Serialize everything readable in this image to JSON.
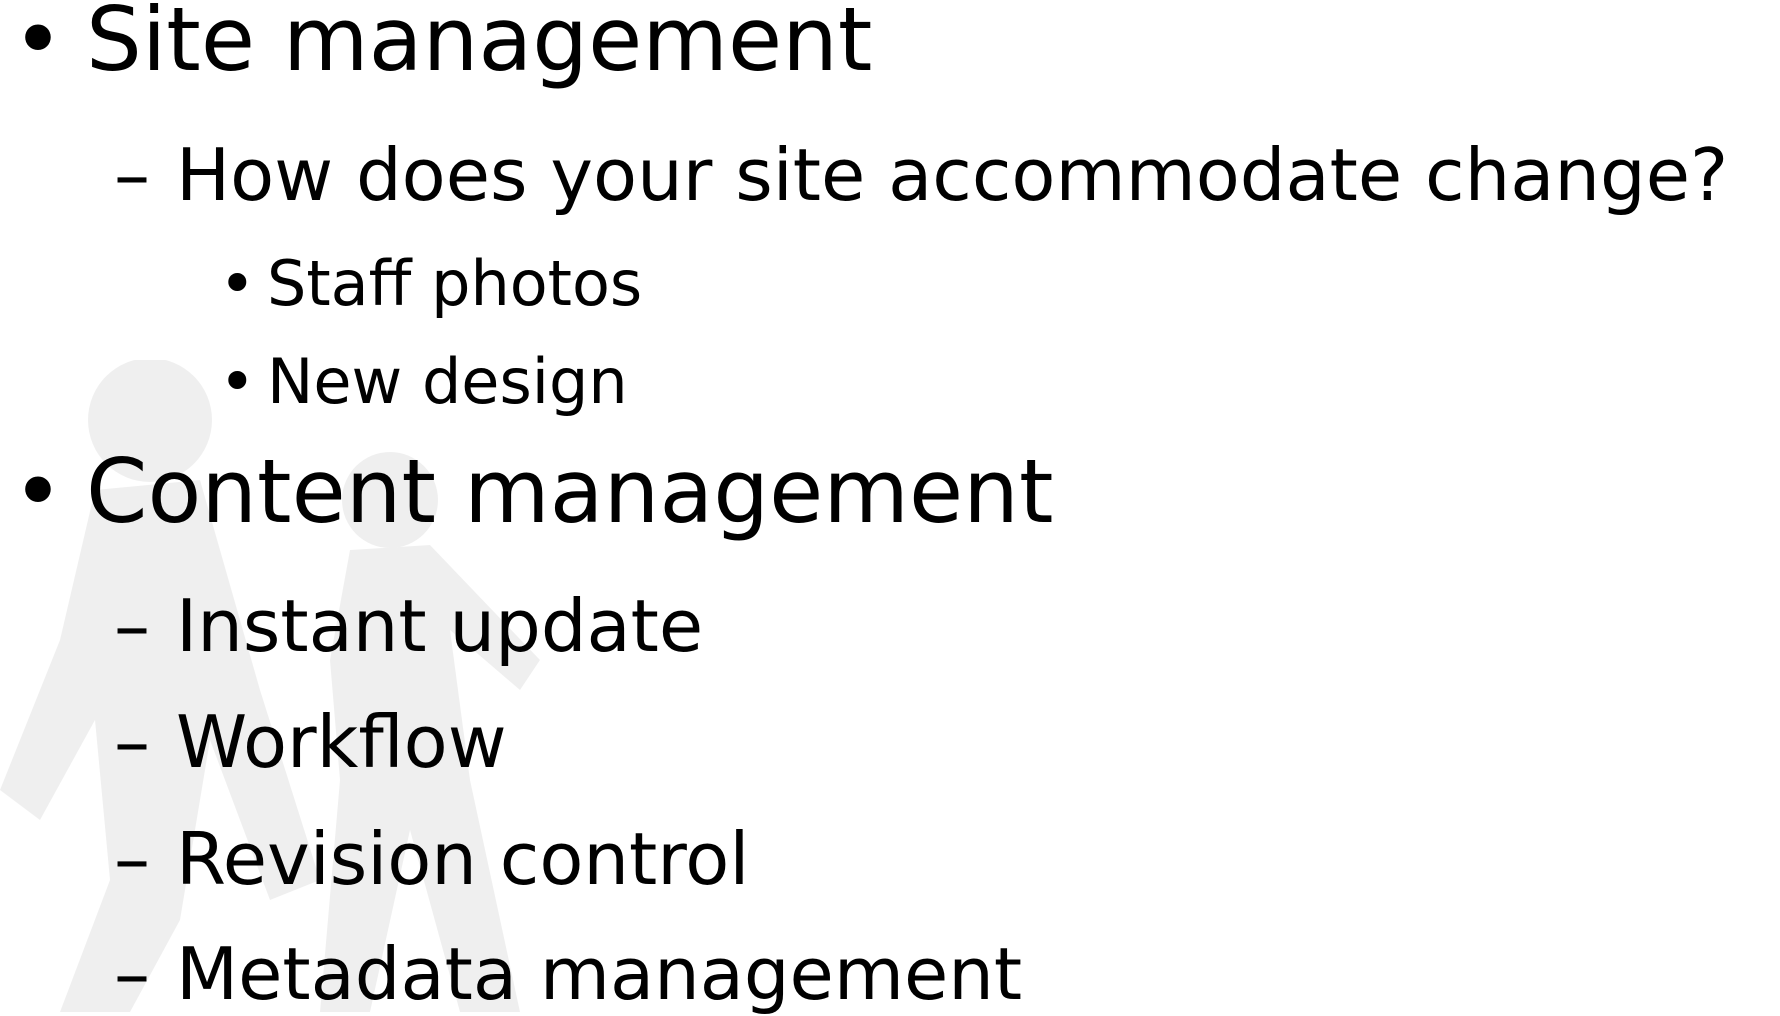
{
  "slide": {
    "bullets": {
      "level1": "•",
      "level2": "–",
      "level3": "•"
    },
    "items": [
      {
        "level": 1,
        "text": "Site management"
      },
      {
        "level": 2,
        "text": "How does your site accommodate change?"
      },
      {
        "level": 3,
        "text": "Staff photos"
      },
      {
        "level": 3,
        "text": "New design"
      },
      {
        "level": 1,
        "text": "Content management"
      },
      {
        "level": 2,
        "text": "Instant update"
      },
      {
        "level": 2,
        "text": "Workflow"
      },
      {
        "level": 2,
        "text": "Revision control"
      },
      {
        "level": 2,
        "text": "Metadata management"
      }
    ],
    "watermark_icon": "walking-figures-icon"
  }
}
